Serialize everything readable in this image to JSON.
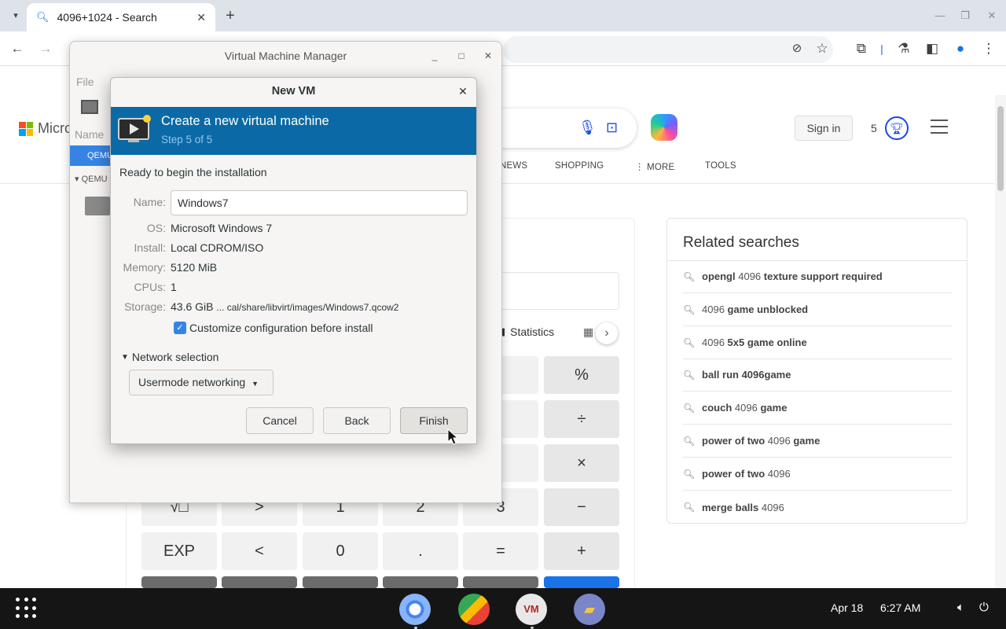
{
  "browser": {
    "tab_title": "4096+1024 - Search",
    "tab_close": "✕",
    "new_tab": "+"
  },
  "bing": {
    "logo_text": "Micros",
    "sign_in": "Sign in",
    "rewards_count": "5",
    "nav_tabs": [
      "NEWS",
      "SHOPPING",
      "MORE",
      "TOOLS"
    ],
    "calc": {
      "statistics_label": "Statistics",
      "keys_row1": [
        "%"
      ],
      "keys_row2": [
        "÷"
      ],
      "keys_row3": [
        "×"
      ],
      "keys_row4": [
        "√□",
        ">",
        "1",
        "2",
        "3",
        "−"
      ],
      "keys_row5": [
        "EXP",
        "<",
        "0",
        ".",
        "=",
        "+"
      ]
    },
    "related": {
      "title": "Related searches",
      "items": [
        {
          "pre": "opengl",
          "num": "4096",
          "post": "texture support required"
        },
        {
          "pre": "",
          "num": "4096",
          "post": "game unblocked"
        },
        {
          "pre": "",
          "num": "4096",
          "post": "5x5 game online"
        },
        {
          "pre": "ball run",
          "num": "",
          "post": "4096game"
        },
        {
          "pre": "couch",
          "num": "4096",
          "post": "game"
        },
        {
          "pre": "power of two",
          "num": "4096",
          "post": "game"
        },
        {
          "pre": "power of two",
          "num": "4096",
          "post": ""
        },
        {
          "pre": "merge balls",
          "num": "4096",
          "post": ""
        }
      ]
    }
  },
  "vmm": {
    "title": "Virtual Machine Manager",
    "menu_file": "File",
    "name_col": "Name",
    "row_selected": "QEMU",
    "row2": "QEMU"
  },
  "dialog": {
    "title": "New VM",
    "banner_heading": "Create a new virtual machine",
    "banner_step": "Step 5 of 5",
    "ready": "Ready to begin the installation",
    "labels": {
      "name": "Name:",
      "os": "OS:",
      "install": "Install:",
      "memory": "Memory:",
      "cpus": "CPUs:",
      "storage": "Storage:"
    },
    "values": {
      "name": "Windows7",
      "os": "Microsoft Windows 7",
      "install": "Local CDROM/ISO",
      "memory": "5120 MiB",
      "cpus": "1",
      "storage_size": "43.6 GiB",
      "storage_path": "... cal/share/libvirt/images/Windows7.qcow2"
    },
    "customize_label": "Customize configuration before install",
    "customize_checked": true,
    "network_expander": "Network selection",
    "network_value": "Usermode networking",
    "buttons": {
      "cancel": "Cancel",
      "back": "Back",
      "finish": "Finish"
    }
  },
  "taskbar": {
    "date": "Apr 18",
    "time": "6:27 AM"
  },
  "colors": {
    "banner": "#0b6aa5",
    "selection": "#3584e4",
    "taskbar": "#151515"
  }
}
